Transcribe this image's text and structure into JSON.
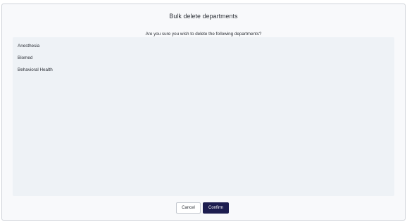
{
  "dialog": {
    "title": "Bulk delete departments",
    "message": "Are you sure you wish to delete the following departments?",
    "departments": [
      "Anesthesia",
      "Biomed",
      "Behavioral Health"
    ],
    "cancel_label": "Cancel",
    "confirm_label": "Confirm"
  },
  "colors": {
    "background": "#f8f9fb",
    "list_panel": "#eef2f6",
    "primary_button": "#1d1d4f",
    "text": "#2b2f36"
  }
}
